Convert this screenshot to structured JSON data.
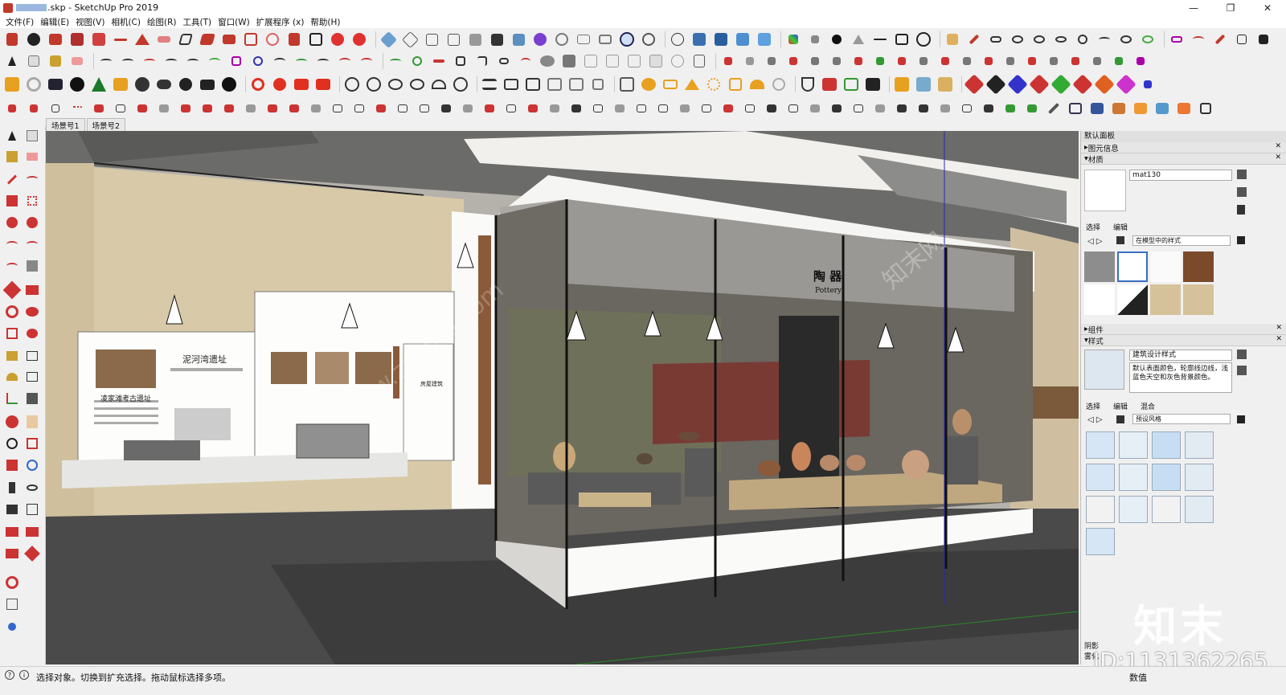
{
  "window": {
    "title": ".skp - SketchUp Pro 2019",
    "controls": [
      "—",
      "❐",
      "✕"
    ]
  },
  "menu": [
    "文件(F)",
    "编辑(E)",
    "视图(V)",
    "相机(C)",
    "绘图(R)",
    "工具(T)",
    "窗口(W)",
    "扩展程序 (x)",
    "帮助(H)"
  ],
  "scene_tabs": [
    "场景号1",
    "场景号2"
  ],
  "viewport": {
    "banner_left_title": "凌家滩考古遗址",
    "banner_mid_title": "泥河湾遗址",
    "banner_small_title": "房屋建筑",
    "case_title_cn": "陶 器",
    "case_title_en": "Pottery"
  },
  "panel": {
    "default_tray": "默认面板",
    "entity_info": "图元信息",
    "materials": "材质",
    "material_name": "mat130",
    "select_tab": "选择",
    "edit_tab": "编辑",
    "material_dropdown": "在模型中的样式",
    "components": "组件",
    "styles": "样式",
    "style_name": "建筑设计样式",
    "style_desc": "默认表面颜色，轮廓线边线，浅蓝色天空和灰色背景颜色。",
    "styles_select": "选择",
    "styles_edit": "编辑",
    "styles_mix": "混合",
    "styles_dropdown": "预设风格",
    "bottom_label_1": "阴影",
    "bottom_label_2": "雾化"
  },
  "status": {
    "message": "选择对象。切换到扩充选择。拖动鼠标选择多项。",
    "value_label": "数值"
  },
  "watermark": {
    "logo": "知末",
    "id": "ID:1131362265",
    "site": "www.znzmo.com",
    "brand": "知末网"
  },
  "colors": {
    "toolbar_red": "#c0392b",
    "panel_bg": "#f0f0f0",
    "viewport_wall": "#d8c9a8",
    "floor": "#4a4a4a"
  }
}
